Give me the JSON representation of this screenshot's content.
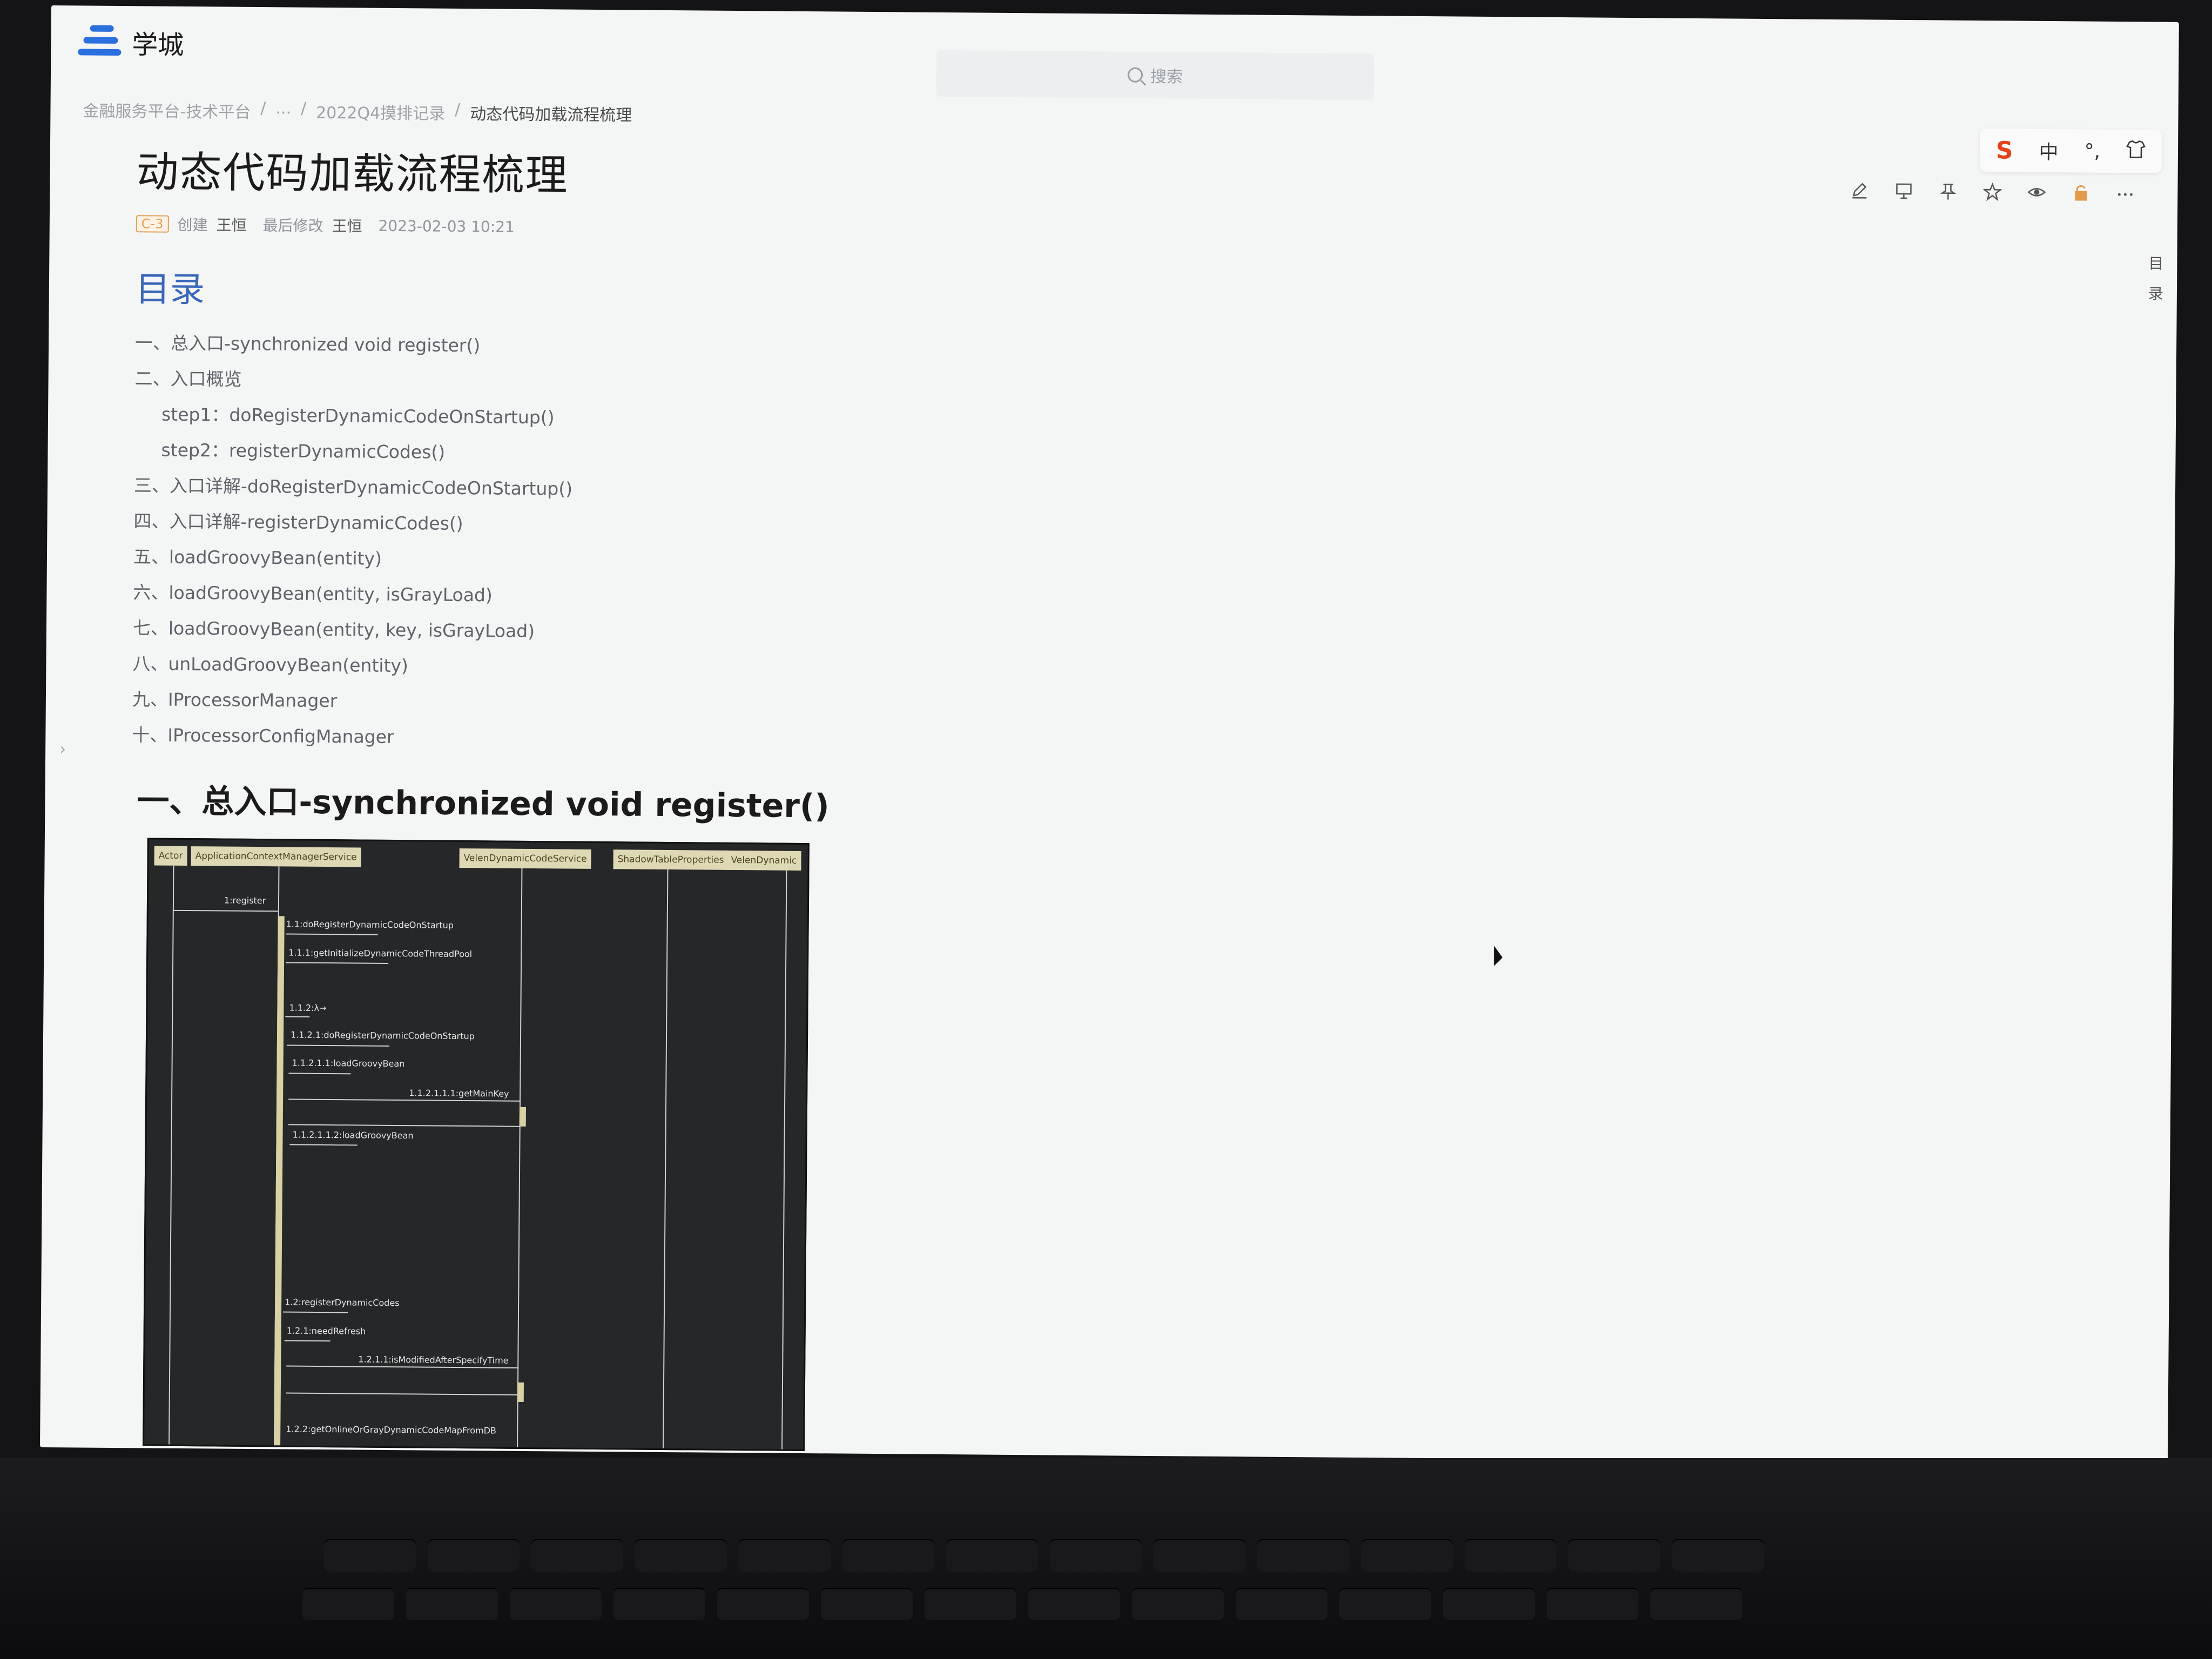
{
  "app": {
    "name": "学城"
  },
  "search": {
    "placeholder": "搜索"
  },
  "breadcrumb": [
    "金融服务平台-技术平台",
    "/",
    "...",
    "/",
    "2022Q4摸排记录",
    "/",
    "动态代码加载流程梳理"
  ],
  "ime_bar": {
    "logo": "S",
    "mode": "中",
    "punct": "°,",
    "skin": "👕"
  },
  "doc": {
    "title": "动态代码加载流程梳理",
    "badge": "C-3",
    "created_label": "创建",
    "creator": "王恒",
    "modified_label": "最后修改",
    "modifier": "王恒",
    "modified_time": "2023-02-03 10:21"
  },
  "toc": {
    "heading": "目录",
    "side_label": "目录",
    "items": [
      {
        "text": "一、总入口-synchronized void register()",
        "sub": false
      },
      {
        "text": "二、入口概览",
        "sub": false
      },
      {
        "text": "step1：doRegisterDynamicCodeOnStartup()",
        "sub": true
      },
      {
        "text": "step2：registerDynamicCodes()",
        "sub": true
      },
      {
        "text": "三、入口详解-doRegisterDynamicCodeOnStartup()",
        "sub": false
      },
      {
        "text": "四、入口详解-registerDynamicCodes()",
        "sub": false
      },
      {
        "text": "五、loadGroovyBean(entity)",
        "sub": false
      },
      {
        "text": "六、loadGroovyBean(entity, isGrayLoad)",
        "sub": false
      },
      {
        "text": "七、loadGroovyBean(entity, key, isGrayLoad)",
        "sub": false
      },
      {
        "text": "八、unLoadGroovyBean(entity)",
        "sub": false
      },
      {
        "text": "九、IProcessorManager",
        "sub": false
      },
      {
        "text": "十、IProcessorConfigManager",
        "sub": false
      }
    ]
  },
  "section1": {
    "heading": "一、总入口-synchronized void register()"
  },
  "diagram": {
    "lanes": [
      "Actor",
      "ApplicationContextManagerService",
      "VelenDynamicCodeService",
      "ShadowTableProperties",
      "VelenDynamic"
    ],
    "messages": [
      "1:register",
      "1.1:doRegisterDynamicCodeOnStartup",
      "1.1.1:getInitializeDynamicCodeThreadPool",
      "1.1.2:λ→",
      "1.1.2.1:doRegisterDynamicCodeOnStartup",
      "1.1.2.1.1:loadGroovyBean",
      "1.1.2.1.1.1:getMainKey",
      "1.1.2.1.1.2:loadGroovyBean",
      "1.2:registerDynamicCodes",
      "1.2.1:needRefresh",
      "1.2.1.1:isModifiedAfterSpecifyTime",
      "1.2.2:getOnlineOrGrayDynamicCodeMapFromDB"
    ]
  },
  "icons": [
    "edit-icon",
    "present-icon",
    "pin-icon",
    "star-icon",
    "eye-icon",
    "lock-icon",
    "more-icon"
  ]
}
